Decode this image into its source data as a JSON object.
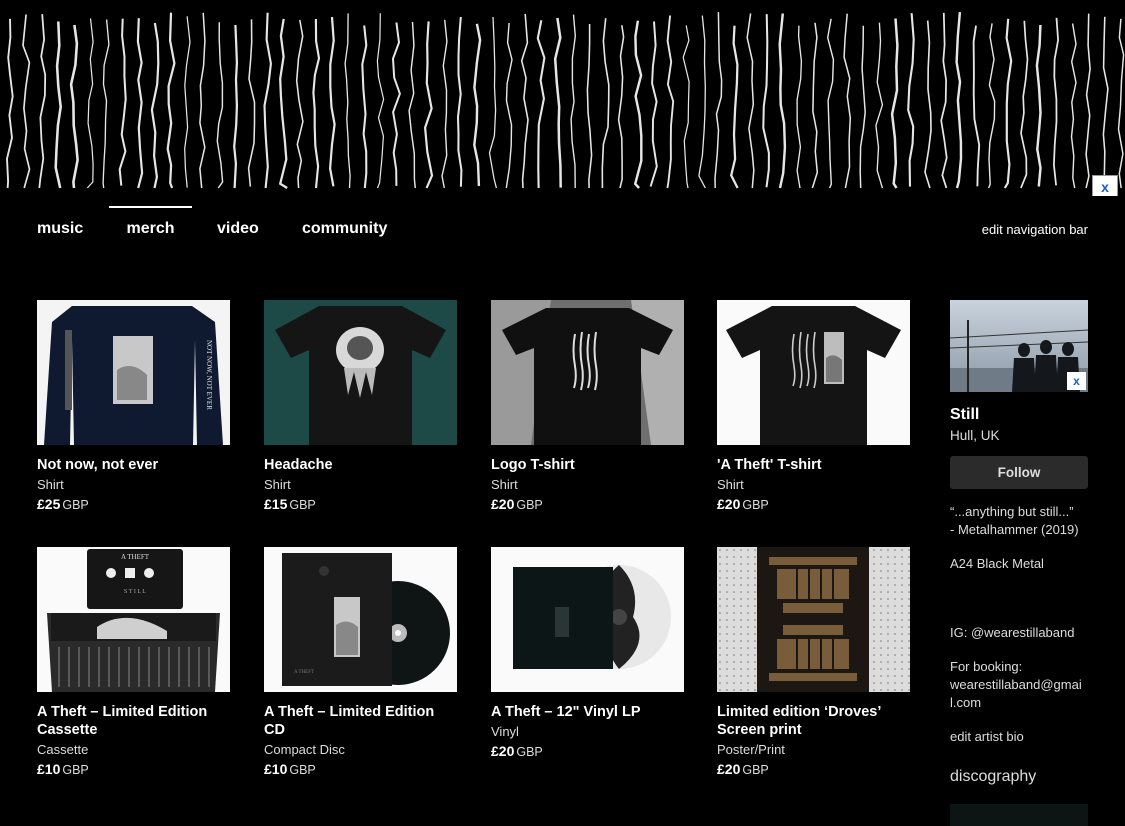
{
  "banner": {
    "close_label": "x"
  },
  "nav": {
    "items": [
      {
        "label": "music",
        "active": false
      },
      {
        "label": "merch",
        "active": true
      },
      {
        "label": "video",
        "active": false
      },
      {
        "label": "community",
        "active": false
      }
    ],
    "edit_label": "edit navigation bar"
  },
  "merch": [
    {
      "title": "Not now, not ever",
      "type": "Shirt",
      "price": "£25",
      "currency": "GBP",
      "print_text": "NOT NOW, NOT EVER"
    },
    {
      "title": "Headache",
      "type": "Shirt",
      "price": "£15",
      "currency": "GBP"
    },
    {
      "title": "Logo T-shirt",
      "type": "Shirt",
      "price": "£20",
      "currency": "GBP"
    },
    {
      "title": "'A Theft' T-shirt",
      "type": "Shirt",
      "price": "£20",
      "currency": "GBP"
    },
    {
      "title": "A Theft – Limited Edition Cassette",
      "type": "Cassette",
      "price": "£10",
      "currency": "GBP",
      "print_text": "A  THEFT",
      "print_text2": "S T I L L"
    },
    {
      "title": "A Theft – Limited Edition CD",
      "type": "Compact Disc",
      "price": "£10",
      "currency": "GBP",
      "print_text": "A  THEFT"
    },
    {
      "title": "A Theft – 12\" Vinyl LP",
      "type": "Vinyl",
      "price": "£20",
      "currency": "GBP"
    },
    {
      "title": "Limited edition ‘Droves’ Screen print",
      "type": "Poster/Print",
      "price": "£20",
      "currency": "GBP"
    }
  ],
  "sidebar": {
    "photo_close_label": "x",
    "band_name": "Still",
    "location": "Hull, UK",
    "follow_label": "Follow",
    "quote_line1": "“...anything but still...”",
    "quote_line2": "- Metalhammer (2019)",
    "genre": "A24 Black Metal",
    "instagram": "IG: @wearestillaband",
    "booking_label": "For booking:",
    "booking_email_1": "wearestillaband@gmai",
    "booking_email_2": "l.com",
    "edit_bio_label": "edit artist bio",
    "discography_heading": "discography"
  },
  "colors": {
    "background": "#000000",
    "accent_close": "#1a5bd6",
    "follow_bg": "#2b2b2b"
  }
}
